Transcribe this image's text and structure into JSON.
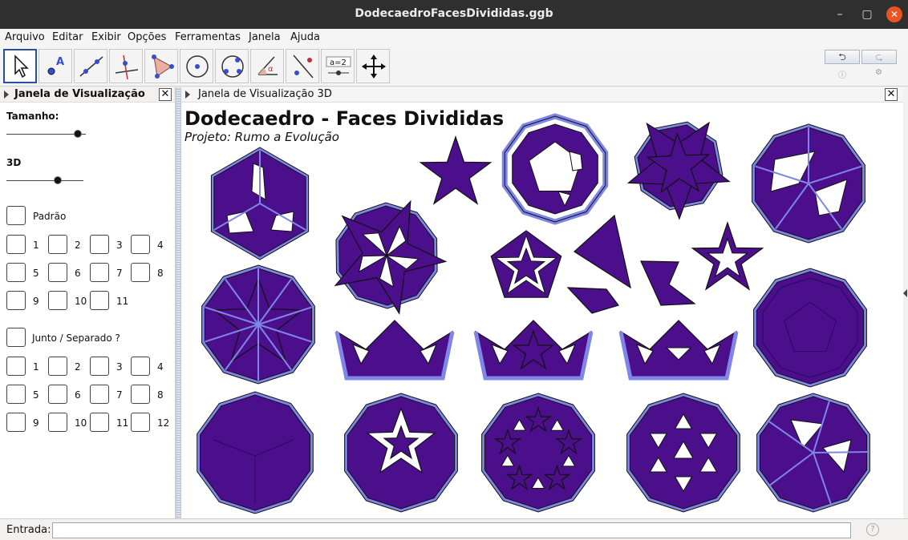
{
  "window": {
    "title": "DodecaedroFacesDivididas.ggb"
  },
  "menu": [
    "Arquivo",
    "Editar",
    "Exibir",
    "Opções",
    "Ferramentas",
    "Janela",
    "Ajuda"
  ],
  "toolbar": {
    "tools": [
      "move-tool",
      "point-tool",
      "line-tool",
      "perpendicular-tool",
      "polygon-tool",
      "circle-center-tool",
      "circle-three-points-tool",
      "angle-tool",
      "reflect-tool",
      "slider-tool",
      "move-view-tool"
    ],
    "slider_tool_text": "a=2",
    "undo": "⮌",
    "redo": "⮎"
  },
  "left_panel": {
    "title": "Janela de Visualização",
    "size_label": "Tamanho:",
    "size_value": 0.9,
    "view3d_label": "3D",
    "view3d_value": 0.67,
    "default_label": "Padrão",
    "group1": [
      "1",
      "2",
      "3",
      "4",
      "5",
      "6",
      "7",
      "8",
      "9",
      "10",
      "11"
    ],
    "together_label": "Junto / Separado ?",
    "group2": [
      "1",
      "2",
      "3",
      "4",
      "5",
      "6",
      "7",
      "8",
      "9",
      "10",
      "11",
      "12"
    ]
  },
  "view3d": {
    "title": "Janela de Visualização 3D",
    "heading": "Dodecaedro - Faces Divididas",
    "subheading": "Projeto: Rumo a Evolução",
    "colors": {
      "face": "#4b0f8c",
      "edge": "#7f86e8",
      "outline": "#111111"
    }
  },
  "footer": {
    "input_label": "Entrada:",
    "input_value": ""
  }
}
